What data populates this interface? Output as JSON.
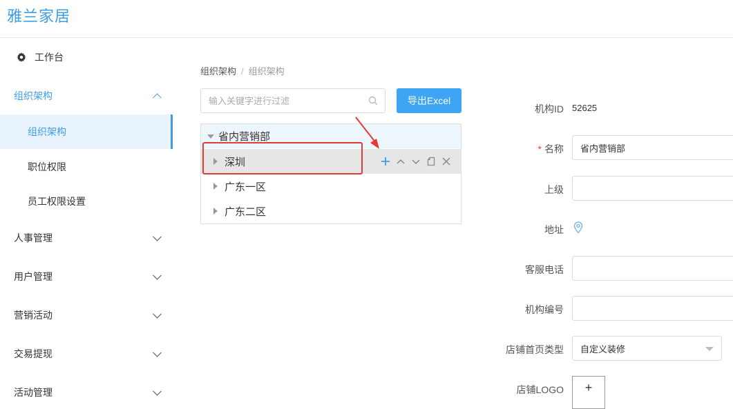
{
  "brand": "雅兰家居",
  "sidebar": {
    "workbench": "工作台",
    "groups": [
      {
        "label": "组织架构",
        "expanded": true,
        "items": [
          {
            "label": "组织架构",
            "active": true
          },
          {
            "label": "职位权限",
            "active": false
          },
          {
            "label": "员工权限设置",
            "active": false
          }
        ]
      },
      {
        "label": "人事管理",
        "expanded": false
      },
      {
        "label": "用户管理",
        "expanded": false
      },
      {
        "label": "营销活动",
        "expanded": false
      },
      {
        "label": "交易提现",
        "expanded": false
      },
      {
        "label": "活动管理",
        "expanded": false
      }
    ]
  },
  "breadcrumb": [
    "组织架构",
    "组织架构"
  ],
  "breadcrumb_sep": "/",
  "search": {
    "placeholder": "输入关键字进行过滤",
    "value": ""
  },
  "export_button": "导出Excel",
  "tree": {
    "root": "省内营销部",
    "children": [
      "深圳",
      "广东一区",
      "广东二区"
    ],
    "hovered_node": "深圳",
    "node_actions": [
      "add-icon",
      "move-up-icon",
      "move-down-icon",
      "copy-icon",
      "delete-icon"
    ]
  },
  "form": {
    "org_id_label": "机构ID",
    "org_id_value": "52625",
    "name_label": "名称",
    "name_required_mark": "*",
    "name_value": "省内营销部",
    "parent_label": "上级",
    "parent_value": "",
    "address_label": "地址",
    "phone_label": "客服电话",
    "phone_value": "",
    "code_label": "机构编号",
    "code_value": "",
    "home_type_label": "店铺首页类型",
    "home_type_value": "自定义装修",
    "logo_label": "店铺LOGO",
    "upload_plus": "+"
  },
  "colors": {
    "accent": "#3d9ee8",
    "button": "#3ea5f4",
    "highlight": "#e53935"
  }
}
